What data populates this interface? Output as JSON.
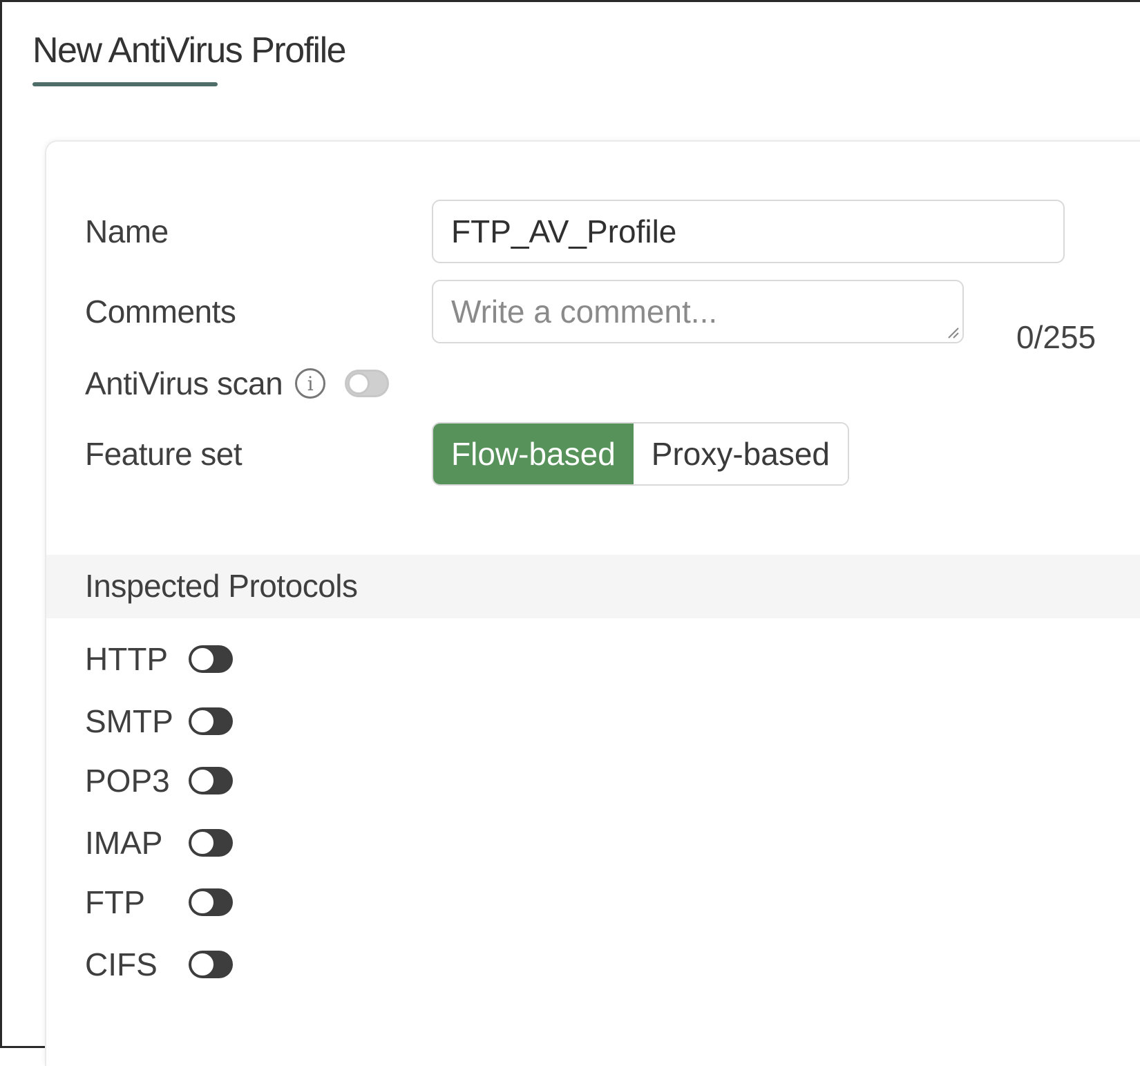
{
  "page": {
    "title": "New AntiVirus Profile"
  },
  "form": {
    "name_label": "Name",
    "name_value": "FTP_AV_Profile",
    "comments_label": "Comments",
    "comments_placeholder": "Write a comment...",
    "comments_counter": "0/255",
    "av_scan_label": "AntiVirus scan",
    "av_scan_enabled": false,
    "info_icon": "info-icon",
    "feature_set_label": "Feature set",
    "feature_set_options": [
      "Flow-based",
      "Proxy-based"
    ],
    "feature_set_selected": "Flow-based"
  },
  "inspected_protocols": {
    "title": "Inspected Protocols",
    "items": [
      {
        "label": "HTTP",
        "enabled": false
      },
      {
        "label": "SMTP",
        "enabled": false
      },
      {
        "label": "POP3",
        "enabled": false
      },
      {
        "label": "IMAP",
        "enabled": false
      },
      {
        "label": "FTP",
        "enabled": false
      },
      {
        "label": "CIFS",
        "enabled": false
      }
    ]
  },
  "colors": {
    "accent_green": "#57925a",
    "title_underline": "#4f6e6a",
    "toggle_off_dark": "#3d3d3d",
    "toggle_disabled": "#cfcfcf"
  }
}
